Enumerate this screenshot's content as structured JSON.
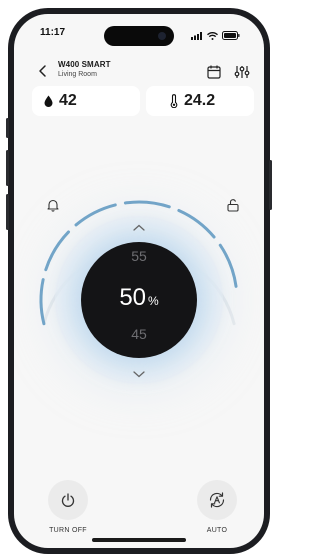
{
  "status_bar": {
    "time": "11:17"
  },
  "header": {
    "device_name": "W400 SMART",
    "room": "Living Room"
  },
  "stats": {
    "humidity": "42",
    "temperature": "24.2"
  },
  "dial": {
    "value": "50",
    "unit": "%",
    "step_above": "55",
    "step_below": "45",
    "accent_color": "#6a9fc4"
  },
  "controls": {
    "power_label": "TURN OFF",
    "auto_label": "AUTO"
  },
  "icons": {
    "back": "chevron-left-icon",
    "calendar": "calendar-icon",
    "settings": "sliders-icon",
    "humidity": "droplet-icon",
    "temperature": "thermometer-icon",
    "alarm": "bell-icon",
    "lock": "unlock-icon",
    "power": "power-icon",
    "auto": "auto-mode-icon"
  }
}
